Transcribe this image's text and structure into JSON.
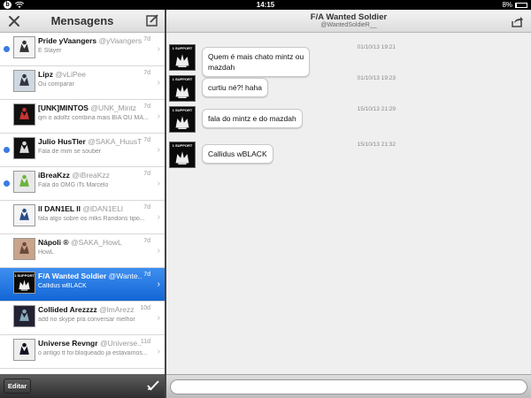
{
  "status_bar": {
    "time": "14:15",
    "battery": "8%",
    "battery_level": 0.08
  },
  "left_panel": {
    "title": "Mensagens",
    "edit_label": "Editar",
    "conversations": [
      {
        "name": "Pride yVaangers",
        "handle": "@yVaangers",
        "preview": "E Slayer",
        "time": "7d",
        "unread": true,
        "avatar": "avatar-pride"
      },
      {
        "name": "Lipz",
        "handle": "@vLiPee",
        "preview": "Ou comparar",
        "time": "7d",
        "unread": false,
        "avatar": "avatar-lipz"
      },
      {
        "name": "[UNK]MINTOS",
        "handle": "@UNK_Mintz",
        "preview": "qm o adolfz combina mais BIA OU MA...",
        "time": "7d",
        "unread": false,
        "avatar": "avatar-unk"
      },
      {
        "name": "Julio HusTler",
        "handle": "@SAKA_HuusT",
        "preview": "Fala de mim se souber",
        "time": "7d",
        "unread": true,
        "avatar": "avatar-julio"
      },
      {
        "name": "iBreaKzz",
        "handle": "@iBreaKzz",
        "preview": "Fala do OMG iTs Marcelo",
        "time": "7d",
        "unread": true,
        "avatar": "avatar-ibreakzz"
      },
      {
        "name": "ll DAN1EL ll",
        "handle": "@lDAN1ELl",
        "preview": "fala algo sobre os mlks Randons tipo...",
        "time": "7d",
        "unread": false,
        "avatar": "avatar-daniel"
      },
      {
        "name": "Nápoli ®",
        "handle": "@SAKA_HowL",
        "preview": "HowL",
        "time": "7d",
        "unread": false,
        "avatar": "avatar-napoli"
      },
      {
        "name": "F/A Wanted Soldier",
        "handle": "@Wante...",
        "preview": "Callidus wBLACK",
        "time": "7d",
        "unread": false,
        "selected": true,
        "avatar": "avatar-wanted"
      },
      {
        "name": "Collided Arezzzz",
        "handle": "@lmArezz",
        "preview": "add no skype pra conversar melhor",
        "time": "10d",
        "unread": false,
        "avatar": "avatar-collided"
      },
      {
        "name": "Universe Revngr",
        "handle": "@Universe...",
        "preview": "o antigo tt foi bloqueado ja estavamos...",
        "time": "11d",
        "unread": false,
        "avatar": "avatar-universe"
      }
    ]
  },
  "right_panel": {
    "title": "F/A Wanted Soldier",
    "subtitle": "@WantedSoldieR__",
    "messages": [
      {
        "text": "Quem é mais chato mintz ou mazdah",
        "line1": "Quem é mais chato mintz ou",
        "line2": "mazdah",
        "time": "01/10/13 19:21"
      },
      {
        "text": "curtiu né?! haha",
        "time": "01/10/13 19:23"
      },
      {
        "text": "fala do mintz e do mazdah",
        "time": "15/10/13 21:29"
      },
      {
        "text": "Callidus wBLACK",
        "time": "15/10/13 21:32"
      }
    ],
    "input_placeholder": ""
  },
  "avatar_text": "1 SUPPORT",
  "colors": {
    "accent": "#1a6fe0",
    "unread": "#3b7be2",
    "header_bg": "#e8e8e8",
    "footer_dark": "#3a3a3a"
  }
}
